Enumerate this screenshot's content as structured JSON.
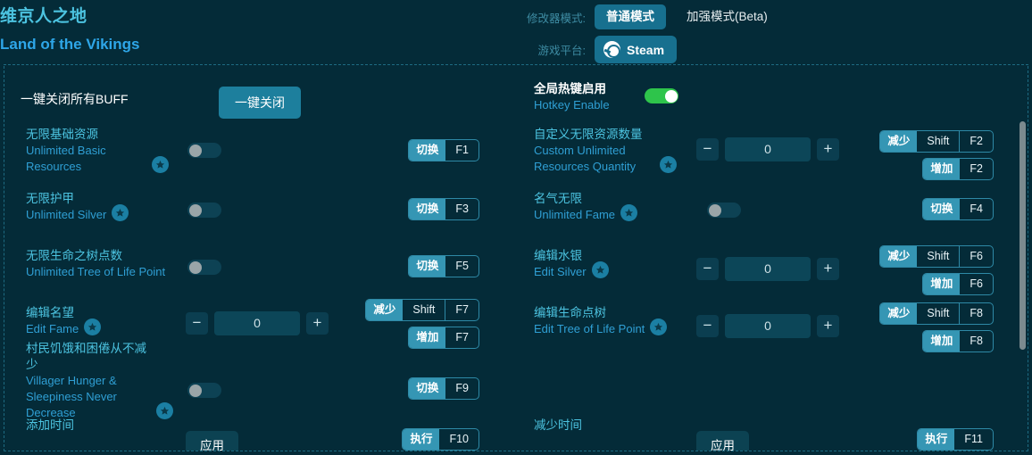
{
  "header": {
    "title_cn": "维京人之地",
    "title_en": "Land of the Vikings",
    "mode_label": "修改器模式:",
    "mode_normal": "普通模式",
    "mode_enhanced": "加强模式(Beta)",
    "platform_label": "游戏平台:",
    "platform_value": "Steam"
  },
  "top": {
    "close_all_label": "一键关闭所有BUFF",
    "close_all_button": "一键关闭",
    "hotkey_cn": "全局热键启用",
    "hotkey_en": "Hotkey Enable",
    "hotkey_state": "on"
  },
  "left_rows": [
    {
      "cn": "无限基础资源",
      "en": "Unlimited Basic Resources",
      "star": true,
      "control": "toggle",
      "toggle_state": "off",
      "hotkeys": [
        {
          "action": "切换",
          "keys": [
            "F1"
          ]
        }
      ]
    },
    {
      "cn": "无限护甲",
      "en": "Unlimited Silver",
      "star": true,
      "control": "toggle",
      "toggle_state": "off",
      "hotkeys": [
        {
          "action": "切换",
          "keys": [
            "F3"
          ]
        }
      ]
    },
    {
      "cn": "无限生命之树点数",
      "en": "Unlimited Tree of Life Point",
      "star": false,
      "control": "toggle",
      "toggle_state": "off",
      "hotkeys": [
        {
          "action": "切换",
          "keys": [
            "F5"
          ]
        }
      ]
    },
    {
      "cn": "编辑名望",
      "en": "Edit Fame",
      "star": true,
      "control": "stepper",
      "value": "0",
      "minus": "−",
      "plus": "+",
      "hotkeys": [
        {
          "action": "减少",
          "keys": [
            "Shift",
            "F7"
          ]
        },
        {
          "action": "增加",
          "keys": [
            "F7"
          ]
        }
      ]
    },
    {
      "cn": "村民饥饿和困倦从不减少",
      "en": "Villager Hunger & Sleepiness Never Decrease",
      "star": true,
      "control": "toggle",
      "toggle_state": "off",
      "hotkeys": [
        {
          "action": "切换",
          "keys": [
            "F9"
          ]
        }
      ]
    },
    {
      "cn": "添加时间",
      "en": "",
      "star": false,
      "control": "apply",
      "apply_label": "应用",
      "hotkeys": [
        {
          "action": "执行",
          "keys": [
            "F10"
          ]
        }
      ]
    }
  ],
  "right_rows": [
    {
      "cn": "自定义无限资源数量",
      "en": "Custom Unlimited Resources Quantity",
      "star": true,
      "control": "stepper",
      "value": "0",
      "minus": "−",
      "plus": "+",
      "hotkeys": [
        {
          "action": "减少",
          "keys": [
            "Shift",
            "F2"
          ]
        },
        {
          "action": "增加",
          "keys": [
            "F2"
          ]
        }
      ]
    },
    {
      "cn": "名气无限",
      "en": "Unlimited Fame",
      "star": true,
      "control": "toggle",
      "toggle_state": "off",
      "hotkeys": [
        {
          "action": "切换",
          "keys": [
            "F4"
          ]
        }
      ]
    },
    {
      "cn": "编辑水银",
      "en": "Edit Silver",
      "star": true,
      "control": "stepper",
      "value": "0",
      "minus": "−",
      "plus": "+",
      "hotkeys": [
        {
          "action": "减少",
          "keys": [
            "Shift",
            "F6"
          ]
        },
        {
          "action": "增加",
          "keys": [
            "F6"
          ]
        }
      ]
    },
    {
      "cn": "编辑生命点树",
      "en": "Edit Tree of Life Point",
      "star": true,
      "control": "stepper",
      "value": "0",
      "minus": "−",
      "plus": "+",
      "hotkeys": [
        {
          "action": "减少",
          "keys": [
            "Shift",
            "F8"
          ]
        },
        {
          "action": "增加",
          "keys": [
            "F8"
          ]
        }
      ]
    },
    {
      "cn": "减少时间",
      "en": "",
      "star": false,
      "control": "apply",
      "apply_label": "应用",
      "hotkeys": [
        {
          "action": "执行",
          "keys": [
            "F11"
          ]
        }
      ]
    }
  ],
  "colors": {
    "background": "#042b38",
    "accent": "#3596b4",
    "title_cn": "#4cc3e0",
    "title_en": "#2ea6e8",
    "toggle_on": "#2ec44b",
    "border_dash": "#1d6b82"
  }
}
